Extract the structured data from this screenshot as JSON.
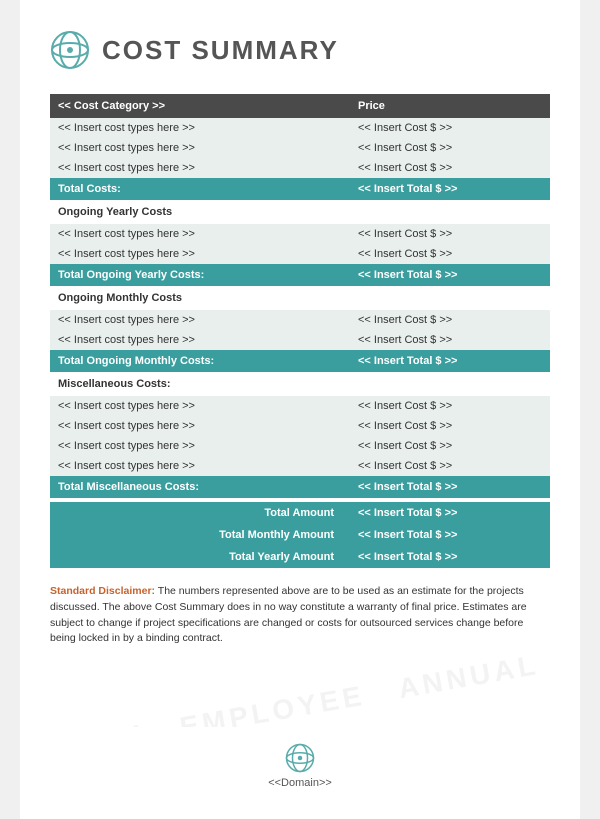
{
  "header": {
    "title": "COST SUMMARY"
  },
  "footer": {
    "domain_label": "<<Domain>>"
  },
  "table": {
    "col_category": "<< Cost Category >>",
    "col_price": "Price",
    "sections": [
      {
        "type": "data",
        "rows": [
          {
            "category": "<< Insert cost types here >>",
            "price": "<< Insert Cost $ >>"
          },
          {
            "category": "<< Insert cost types here >>",
            "price": "<< Insert Cost $ >>"
          },
          {
            "category": "<< Insert cost types here >>",
            "price": "<< Insert Cost $ >>"
          }
        ]
      },
      {
        "type": "total",
        "label": "Total Costs:",
        "price": "<< Insert Total $ >>"
      },
      {
        "type": "section-header",
        "label": "Ongoing Yearly Costs"
      },
      {
        "type": "data",
        "rows": [
          {
            "category": "<< Insert cost types here >>",
            "price": "<< Insert Cost $ >>"
          },
          {
            "category": "<< Insert cost types here >>",
            "price": "<< Insert Cost $ >>"
          }
        ]
      },
      {
        "type": "total",
        "label": "Total Ongoing Yearly Costs:",
        "price": "<< Insert Total $ >>"
      },
      {
        "type": "section-header",
        "label": "Ongoing Monthly Costs"
      },
      {
        "type": "data",
        "rows": [
          {
            "category": "<< Insert cost types here >>",
            "price": "<< Insert Cost $ >>"
          },
          {
            "category": "<< Insert cost types here >>",
            "price": "<< Insert Cost $ >>"
          }
        ]
      },
      {
        "type": "total",
        "label": "Total Ongoing Monthly Costs:",
        "price": "<< Insert Total $ >>"
      },
      {
        "type": "section-header",
        "label": "Miscellaneous Costs:"
      },
      {
        "type": "data",
        "rows": [
          {
            "category": "<< Insert cost types here >>",
            "price": "<< Insert Cost $ >>"
          },
          {
            "category": "<< Insert cost types here >>",
            "price": "<< Insert Cost $ >>"
          },
          {
            "category": "<< Insert cost types here >>",
            "price": "<< Insert Cost $ >>"
          },
          {
            "category": "<< Insert cost types here >>",
            "price": "<< Insert Cost $ >>"
          }
        ]
      },
      {
        "type": "total",
        "label": "Total Miscellaneous Costs:",
        "price": "<< Insert Total $ >>"
      },
      {
        "type": "summary",
        "rows": [
          {
            "label": "Total Amount",
            "price": "<< Insert Total $ >>"
          },
          {
            "label": "Total Monthly Amount",
            "price": "<< Insert Total $ >>"
          },
          {
            "label": "Total Yearly Amount",
            "price": "<< Insert Total $ >>"
          }
        ]
      }
    ]
  },
  "disclaimer": {
    "label": "Standard Disclaimer:",
    "text": " The numbers represented above are to be used as an estimate for the projects discussed. The above Cost Summary does in no way constitute a warranty of final price.  Estimates are subject to change if project specifications are changed or costs for outsourced services change before being locked in by a binding contract."
  }
}
